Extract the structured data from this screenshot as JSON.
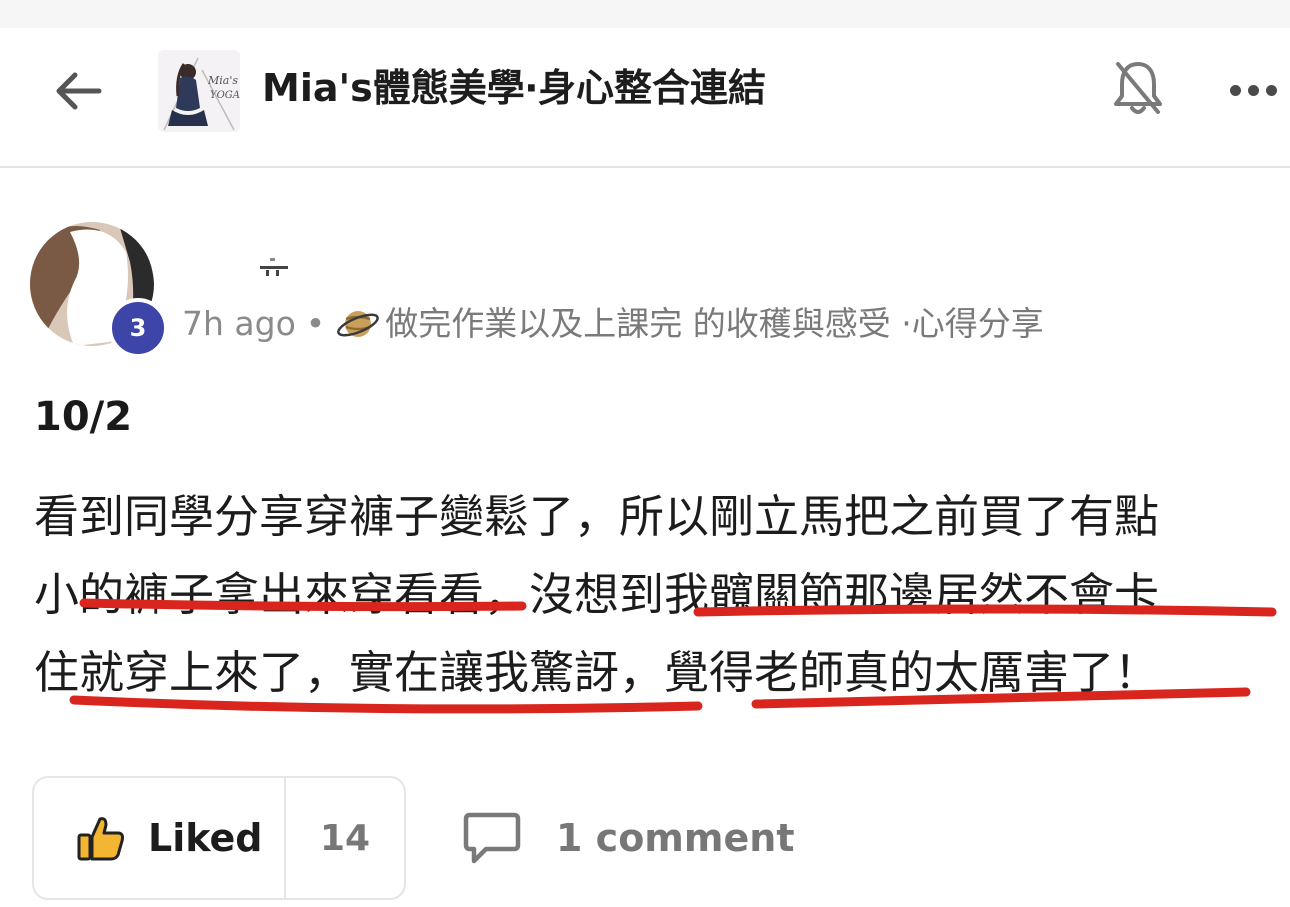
{
  "header": {
    "title": "Mia's體態美學‧身心整合連結",
    "logo_text_line1": "Mia's",
    "logo_text_line2": "YOGA"
  },
  "post": {
    "author_level": "3",
    "time": "7h ago",
    "separator": "•",
    "category": "做完作業以及上課完 的收穫與感受 ·心得分享",
    "title": "10/2",
    "body_lines": [
      "看到同學分享穿褲子變鬆了，所以剛立馬把之前買了有點",
      "小的褲子拿出來穿看看，沒想到我髖關節那邊居然不會卡",
      "住就穿上來了，實在讓我驚訝，覺得老師真的太厲害了！"
    ]
  },
  "actions": {
    "like_label": "Liked",
    "like_count": "14",
    "comment_label": "1 comment"
  },
  "colors": {
    "badge": "#3d46a8",
    "underline": "#d8261e",
    "muted_text": "#8a8a8a",
    "liked_thumb": "#f2b632"
  },
  "icons": {
    "back": "arrow-left-icon",
    "bell": "bell-off-icon",
    "more": "more-horizontal-icon",
    "category": "planet-icon",
    "like": "thumbs-up-icon",
    "comment": "comment-bubble-icon"
  }
}
